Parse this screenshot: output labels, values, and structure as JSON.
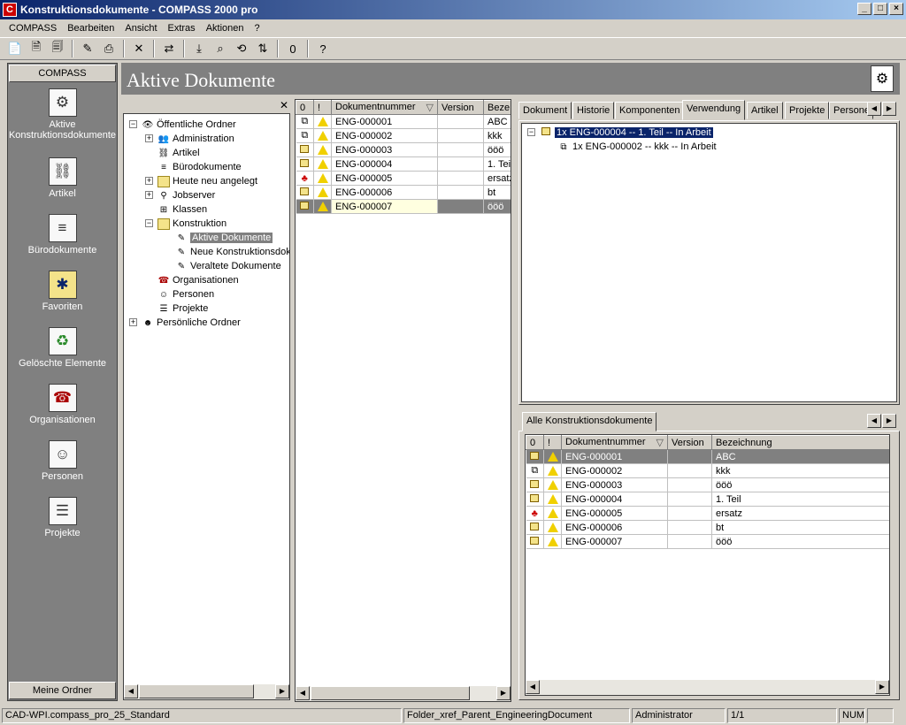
{
  "window": {
    "title": "Konstruktionsdokumente - COMPASS 2000 pro",
    "app_icon": "C"
  },
  "menu": [
    "COMPASS",
    "Bearbeiten",
    "Ansicht",
    "Extras",
    "Aktionen",
    "?"
  ],
  "toolbar_icons": [
    "new-doc-icon",
    "new-part-icon",
    "new-folder-icon",
    "edit-icon",
    "print-icon",
    "delete-icon",
    "compare-icon",
    "checkout-icon",
    "search-doc-icon",
    "workflow-icon",
    "sync-icon",
    "link-icon",
    "help-icon"
  ],
  "leftnav": {
    "header": "COMPASS",
    "footer": "Meine Ordner",
    "items": [
      {
        "label": "Aktive Konstruktionsdokumente",
        "icon": "gear-document-icon",
        "glyph": "⚙"
      },
      {
        "label": "Artikel",
        "icon": "part-icon",
        "glyph": "⛓"
      },
      {
        "label": "Bürodokumente",
        "icon": "office-document-icon",
        "glyph": "≡"
      },
      {
        "label": "Favoriten",
        "icon": "favorites-folder-icon",
        "glyph": "✱"
      },
      {
        "label": "Gelöschte Elemente",
        "icon": "recycle-bin-icon",
        "glyph": "♻"
      },
      {
        "label": "Organisationen",
        "icon": "organization-icon",
        "glyph": "☎"
      },
      {
        "label": "Personen",
        "icon": "person-icon",
        "glyph": "☺"
      },
      {
        "label": "Projekte",
        "icon": "project-icon",
        "glyph": "☰"
      }
    ]
  },
  "header": {
    "title": "Aktive Dokumente"
  },
  "tree": {
    "close": "✕",
    "items": [
      {
        "label": "Öffentliche Ordner",
        "level": 0,
        "expander": "−",
        "icon": "public-folder-icon"
      },
      {
        "label": "Administration",
        "level": 1,
        "expander": "+",
        "icon": "admin-icon"
      },
      {
        "label": "Artikel",
        "level": 1,
        "expander": "",
        "icon": "part-icon"
      },
      {
        "label": "Bürodokumente",
        "level": 1,
        "expander": "",
        "icon": "office-document-icon"
      },
      {
        "label": "Heute neu angelegt",
        "level": 1,
        "expander": "+",
        "icon": "folder-icon"
      },
      {
        "label": "Jobserver",
        "level": 1,
        "expander": "+",
        "icon": "jobserver-icon"
      },
      {
        "label": "Klassen",
        "level": 1,
        "expander": "",
        "icon": "class-icon"
      },
      {
        "label": "Konstruktion",
        "level": 1,
        "expander": "−",
        "icon": "folder-icon"
      },
      {
        "label": "Aktive Dokumente",
        "level": 2,
        "expander": "",
        "icon": "document-icon",
        "selected": true
      },
      {
        "label": "Neue Konstruktionsdok",
        "level": 2,
        "expander": "",
        "icon": "document-icon"
      },
      {
        "label": "Veraltete Dokumente",
        "level": 2,
        "expander": "",
        "icon": "document-icon"
      },
      {
        "label": "Organisationen",
        "level": 1,
        "expander": "",
        "icon": "organization-icon"
      },
      {
        "label": "Personen",
        "level": 1,
        "expander": "",
        "icon": "person-icon"
      },
      {
        "label": "Projekte",
        "level": 1,
        "expander": "",
        "icon": "project-icon"
      },
      {
        "label": "Persönliche Ordner",
        "level": 0,
        "expander": "+",
        "icon": "personal-folder-icon"
      }
    ]
  },
  "doclist": {
    "columns": [
      "0",
      "!",
      "Dokumentnummer",
      "Version",
      "Beze"
    ],
    "sort_glyph": "▽",
    "rows": [
      {
        "type": "assembly",
        "num": "ENG-000001",
        "version": "",
        "desc": "ABC"
      },
      {
        "type": "assembly",
        "num": "ENG-000002",
        "version": "",
        "desc": "kkk"
      },
      {
        "type": "part",
        "num": "ENG-000003",
        "version": "",
        "desc": "ööö"
      },
      {
        "type": "part",
        "num": "ENG-000004",
        "version": "",
        "desc": "1. Teil"
      },
      {
        "type": "replace",
        "num": "ENG-000005",
        "version": "",
        "desc": "ersatz"
      },
      {
        "type": "part",
        "num": "ENG-000006",
        "version": "",
        "desc": "bt"
      },
      {
        "type": "part",
        "num": "ENG-000007",
        "version": "",
        "desc": "ööö"
      }
    ]
  },
  "detail_tabs": [
    "Dokument",
    "Historie",
    "Komponenten",
    "Verwendung",
    "Artikel",
    "Projekte",
    "Persone"
  ],
  "usage_tree": [
    {
      "label": "1x ENG-000004  -- 1. Teil -- In Arbeit",
      "level": 0
    },
    {
      "label": "1x ENG-000002  -- kkk -- In Arbeit",
      "level": 1
    }
  ],
  "bottom": {
    "tab": "Alle Konstruktionsdokumente",
    "columns": [
      "0",
      "!",
      "Dokumentnummer",
      "Version",
      "Bezeichnung"
    ],
    "rows": [
      {
        "type": "part",
        "num": "ENG-000001",
        "version": "",
        "desc": "ABC"
      },
      {
        "type": "assembly",
        "num": "ENG-000002",
        "version": "",
        "desc": "kkk"
      },
      {
        "type": "part",
        "num": "ENG-000003",
        "version": "",
        "desc": "ööö"
      },
      {
        "type": "part",
        "num": "ENG-000004",
        "version": "",
        "desc": "1. Teil"
      },
      {
        "type": "replace",
        "num": "ENG-000005",
        "version": "",
        "desc": "ersatz"
      },
      {
        "type": "part",
        "num": "ENG-000006",
        "version": "",
        "desc": "bt"
      },
      {
        "type": "part",
        "num": "ENG-000007",
        "version": "",
        "desc": "ööö"
      }
    ]
  },
  "status": {
    "connection": "CAD-WPI.compass_pro_25_Standard",
    "folder": "Folder_xref_Parent_EngineeringDocument",
    "user": "Administrator",
    "pages": "1/1",
    "num": "NUM"
  },
  "colors": {
    "title_start": "#0a246a",
    "title_end": "#a6caf0",
    "nav_bg": "#808080",
    "warning": "#f0d000"
  }
}
